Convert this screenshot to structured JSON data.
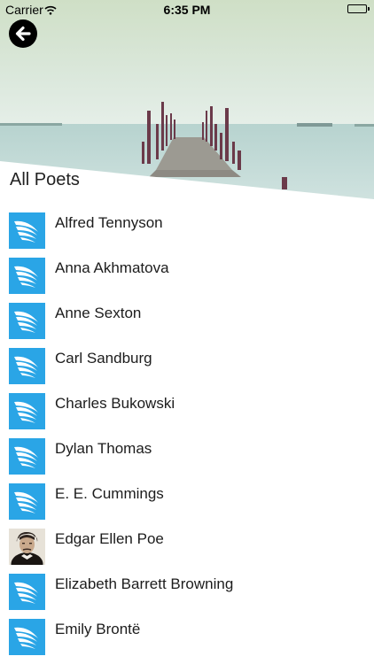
{
  "status_bar": {
    "carrier": "Carrier",
    "time": "6:35 PM"
  },
  "header": {
    "back_icon": "arrow-left-icon",
    "section_title": "All Poets"
  },
  "colors": {
    "accent": "#2aa5e6",
    "sky_top": "#cfe0c9",
    "sea": "#b9d5d2"
  },
  "poets": [
    {
      "name": "Alfred Tennyson",
      "icon": "wing-icon"
    },
    {
      "name": "Anna Akhmatova",
      "icon": "wing-icon"
    },
    {
      "name": "Anne Sexton",
      "icon": "wing-icon"
    },
    {
      "name": "Carl Sandburg",
      "icon": "wing-icon"
    },
    {
      "name": "Charles Bukowski",
      "icon": "wing-icon"
    },
    {
      "name": "Dylan Thomas",
      "icon": "wing-icon"
    },
    {
      "name": "E. E. Cummings",
      "icon": "wing-icon"
    },
    {
      "name": "Edgar Ellen Poe",
      "icon": "portrait"
    },
    {
      "name": "Elizabeth Barrett Browning",
      "icon": "wing-icon"
    },
    {
      "name": "Emily Brontë",
      "icon": "wing-icon"
    }
  ]
}
